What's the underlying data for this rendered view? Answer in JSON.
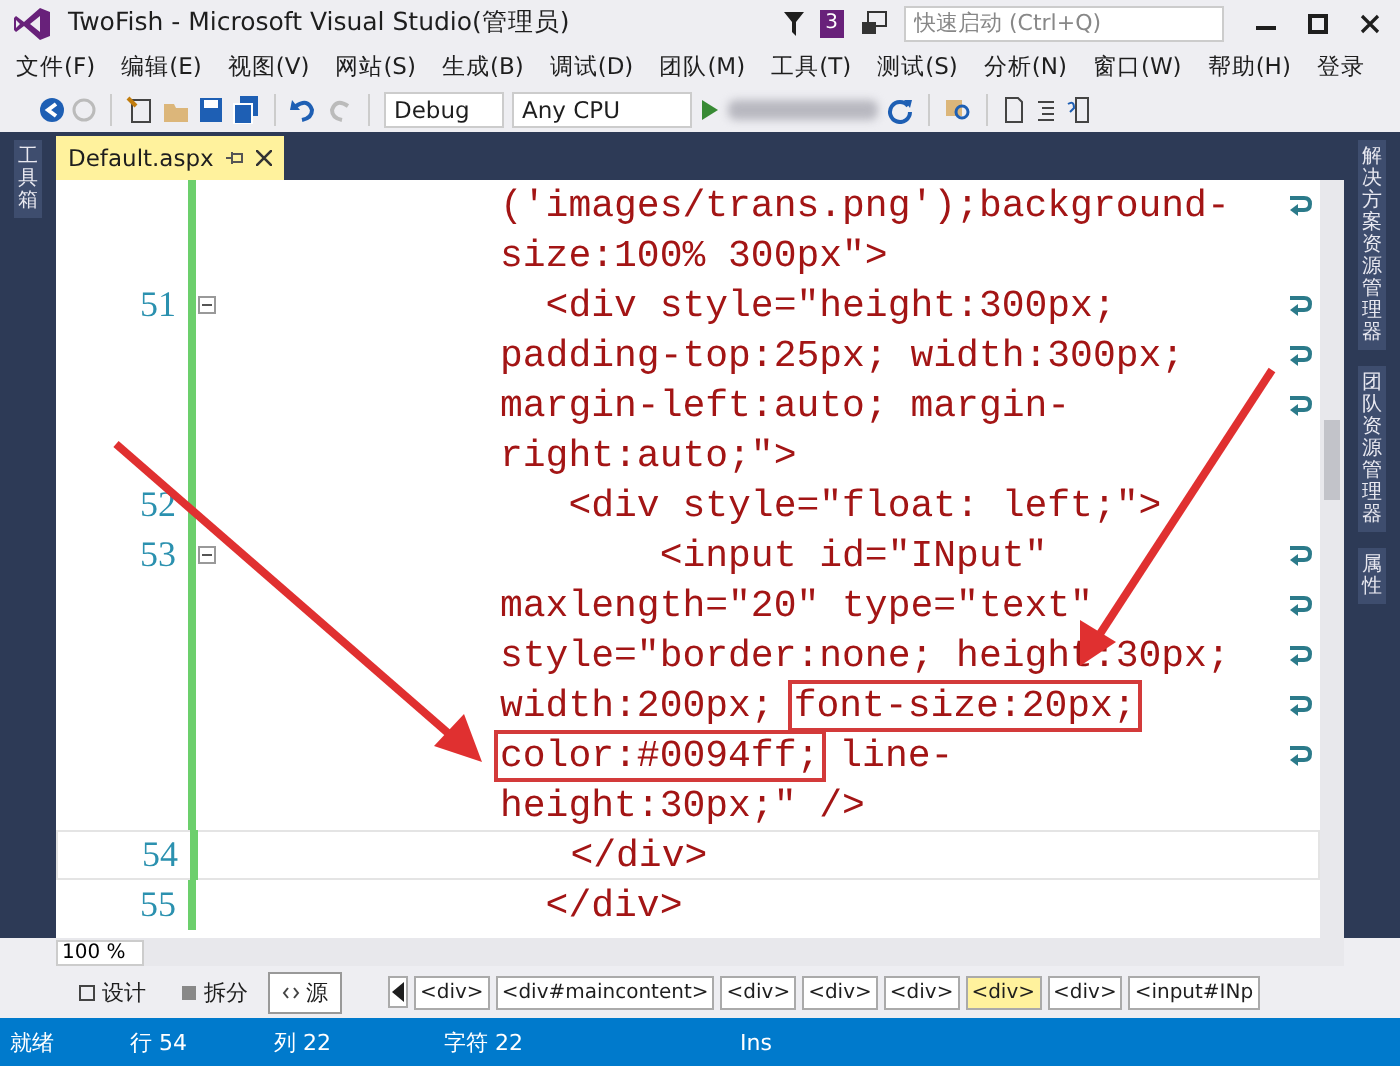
{
  "window": {
    "title": "TwoFish - Microsoft Visual Studio(管理员)",
    "notification_count": "3",
    "quick_launch": {
      "placeholder": "快速启动 (Ctrl+Q)"
    }
  },
  "menu": [
    "文件(F)",
    "编辑(E)",
    "视图(V)",
    "网站(S)",
    "生成(B)",
    "调试(D)",
    "团队(M)",
    "工具(T)",
    "测试(S)",
    "分析(N)",
    "窗口(W)",
    "帮助(H)"
  ],
  "sign_in": "登录",
  "toolbar": {
    "configuration": "Debug",
    "platform": "Any CPU"
  },
  "left_panel_tabs": [
    "工具箱"
  ],
  "document_tabs": [
    {
      "label": "Default.aspx",
      "selected": true
    }
  ],
  "editor": {
    "rows": [
      {
        "text": "('images/trans.png');background-",
        "wrapped": true,
        "current": false
      },
      {
        "text": "size:100% 300px\">",
        "wrapped": false,
        "current": false
      },
      {
        "number": "51",
        "text": "  <div style=\"height:300px;",
        "wrapped": true,
        "current": false
      },
      {
        "text": "padding-top:25px; width:300px;",
        "wrapped": true,
        "current": false
      },
      {
        "text": "margin-left:auto; margin-",
        "wrapped": true,
        "current": false
      },
      {
        "text": "right:auto;\">",
        "wrapped": false,
        "current": false
      },
      {
        "number": "52",
        "text": "   <div style=\"float: left;\">",
        "wrapped": false,
        "current": false
      },
      {
        "number": "53",
        "text": "       <input id=\"INput\"",
        "wrapped": true,
        "current": false
      },
      {
        "text": "maxlength=\"20\" type=\"text\"",
        "wrapped": true,
        "current": false
      },
      {
        "text": "style=\"border:none; height:30px;",
        "wrapped": true,
        "current": false
      },
      {
        "parts": [
          {
            "text": "width:200px;",
            "highlighted": false
          },
          {
            "text": "font-size:20px;",
            "highlighted": true
          }
        ],
        "wrapped": true,
        "current": false
      },
      {
        "parts": [
          {
            "text": "color:#0094ff;",
            "highlighted": true
          },
          {
            "text": "line-",
            "highlighted": false
          }
        ],
        "wrapped": true,
        "current": false
      },
      {
        "text": "height:30px;\" />",
        "wrapped": false,
        "current": false
      },
      {
        "number": "54",
        "text": "   </div>",
        "wrapped": false,
        "current": true
      },
      {
        "number": "55",
        "text": "  </div>",
        "wrapped": false,
        "current": false
      }
    ]
  },
  "right_panel_tabs": [
    "解决方案资源管理器",
    "团队资源管理器",
    "属性"
  ],
  "zoom": "100 %",
  "view_tabs": [
    {
      "label": "设计",
      "selected": false
    },
    {
      "label": "拆分",
      "selected": false
    },
    {
      "label": "源",
      "selected": true
    }
  ],
  "breadcrumbs": [
    {
      "label": "<div>",
      "selected": false
    },
    {
      "label": "<div#maincontent>",
      "selected": false
    },
    {
      "label": "<div>",
      "selected": false
    },
    {
      "label": "<div>",
      "selected": false
    },
    {
      "label": "<div>",
      "selected": false
    },
    {
      "label": "<div>",
      "selected": true
    },
    {
      "label": "<div>",
      "selected": false
    },
    {
      "label": "<input#INp",
      "selected": false
    }
  ],
  "status_bar": [
    "就绪",
    "行 54",
    "列 22",
    "字符 22",
    "Ins"
  ]
}
